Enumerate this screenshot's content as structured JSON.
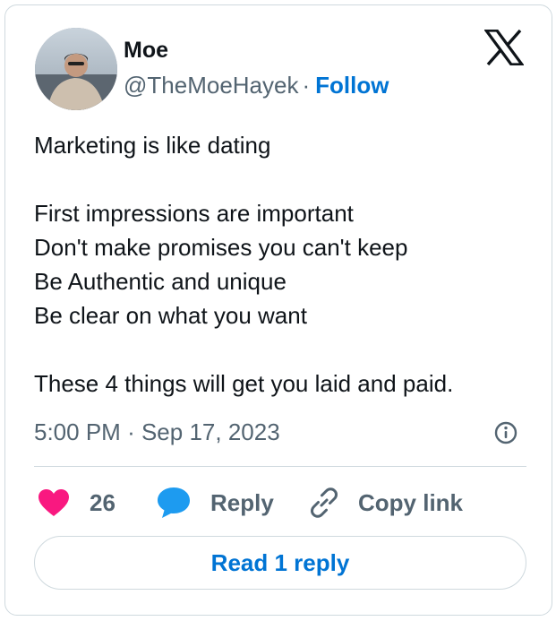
{
  "author": {
    "name": "Moe",
    "handle": "@TheMoeHayek",
    "separator": "·",
    "follow_label": "Follow",
    "avatar_icon": "profile-photo"
  },
  "logo_icon": "x-logo-icon",
  "tweet": {
    "lines": [
      "Marketing is like dating",
      "",
      "First impressions are important",
      "Don't make promises you can't keep",
      "Be Authentic and unique",
      "Be clear on what you want",
      "",
      "These 4 things will get you laid and paid."
    ],
    "time": "5:00 PM",
    "date_separator": "·",
    "date": "Sep 17, 2023"
  },
  "actions": {
    "like_count": "26",
    "reply_label": "Reply",
    "copy_link_label": "Copy link"
  },
  "read_replies_label": "Read 1 reply",
  "colors": {
    "like": "#f91880",
    "reply": "#1d9bf0",
    "link": "#0074d4",
    "muted": "#536471",
    "border": "#cfd9de"
  }
}
